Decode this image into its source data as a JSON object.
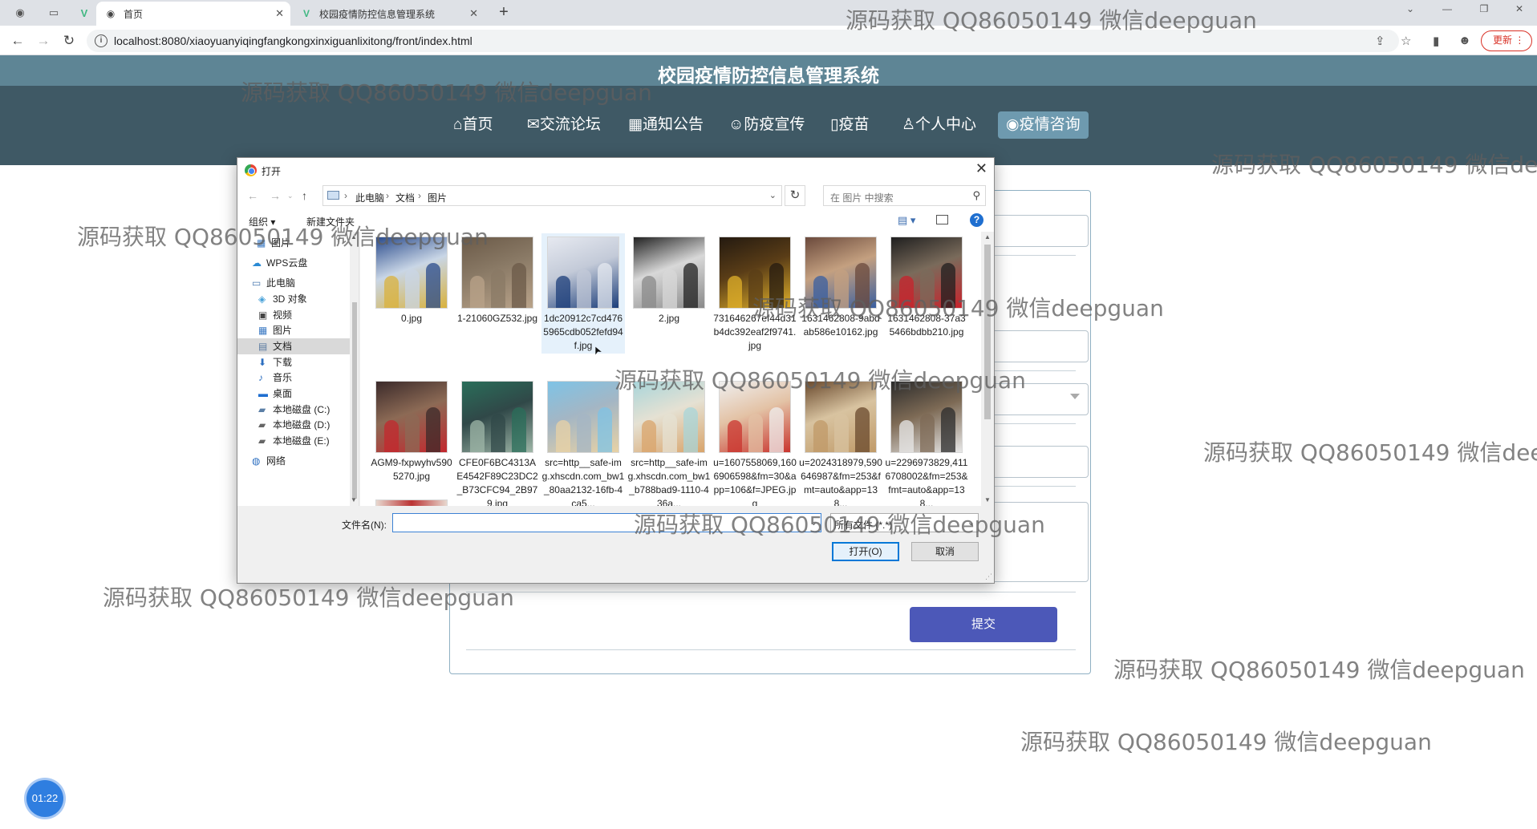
{
  "browser": {
    "tabs": [
      {
        "label": "首页",
        "favicon": "globe-icon"
      },
      {
        "label": "校园疫情防控信息管理系统",
        "favicon": "vue-logo-icon"
      }
    ],
    "url": "localhost:8080/xiaoyuanyiqingfangkongxinxiguanlixitong/front/index.html",
    "update_label": "更新"
  },
  "site": {
    "title": "校园疫情防控信息管理系统",
    "nav": [
      {
        "icon": "⌂",
        "label": "首页"
      },
      {
        "icon": "✉",
        "label": "交流论坛"
      },
      {
        "icon": "▦",
        "label": "通知公告"
      },
      {
        "icon": "☺",
        "label": "防疫宣传"
      },
      {
        "icon": "▯",
        "label": "疫苗"
      },
      {
        "icon": "♙",
        "label": "个人中心"
      },
      {
        "icon": "◉",
        "label": "疫情咨询"
      }
    ],
    "active_nav": "疫情咨询",
    "accent_color": "#4c58b8"
  },
  "form": {
    "submit_label": "提交"
  },
  "timer": "01:22",
  "dialog": {
    "title": "打开",
    "breadcrumb": [
      "此电脑",
      "文档",
      "图片"
    ],
    "search_placeholder": "在 图片 中搜索",
    "organize_label": "组织 ▾",
    "new_folder_label": "新建文件夹",
    "sidebar": [
      {
        "label": "图片",
        "icon": "pictures-folder-icon"
      },
      {
        "label": "WPS云盘",
        "icon": "cloud-icon"
      },
      {
        "label": "此电脑",
        "icon": "computer-icon"
      },
      {
        "label": "3D 对象",
        "icon": "3d-objects-icon"
      },
      {
        "label": "视频",
        "icon": "video-folder-icon"
      },
      {
        "label": "图片",
        "icon": "pictures-folder-icon"
      },
      {
        "label": "文档",
        "icon": "documents-folder-icon",
        "selected": true
      },
      {
        "label": "下载",
        "icon": "download-icon"
      },
      {
        "label": "音乐",
        "icon": "music-icon"
      },
      {
        "label": "桌面",
        "icon": "desktop-icon"
      },
      {
        "label": "本地磁盘 (C:)",
        "icon": "drive-c-icon"
      },
      {
        "label": "本地磁盘 (D:)",
        "icon": "drive-icon"
      },
      {
        "label": "本地磁盘 (E:)",
        "icon": "drive-icon"
      },
      {
        "label": "网络",
        "icon": "network-icon"
      }
    ],
    "files": [
      {
        "name": "0.jpg",
        "thumb": [
          "#2a4b8c",
          "#d9b23d",
          "#c9d6e6"
        ]
      },
      {
        "name": "1-21060GZ532.jpg",
        "thumb": [
          "#6b5a48",
          "#b9a38a",
          "#8a7a66"
        ]
      },
      {
        "name": "1dc20912c7cd4765965cdb052fefd94f.jpg",
        "thumb": [
          "#e6e9f0",
          "#1c3e7a",
          "#c3cad8"
        ],
        "selected": true
      },
      {
        "name": "2.jpg",
        "thumb": [
          "#222222",
          "#8a8a8a",
          "#d8d8d8"
        ]
      },
      {
        "name": "731646267ef44d31b4dc392eaf2f9741.jpg",
        "thumb": [
          "#241a10",
          "#e0b02a",
          "#5a3d17"
        ]
      },
      {
        "name": "1631462808-9abdab586e10162.jpg",
        "thumb": [
          "#6b4a3c",
          "#3a5fa0",
          "#c4a080"
        ]
      },
      {
        "name": "1631462808-37a35466bdbb210.jpg",
        "thumb": [
          "#1f1f1f",
          "#c8232c",
          "#7a6b5b"
        ]
      },
      {
        "name": "AGM9-fxpwyhv5905270.jpg",
        "thumb": [
          "#3b2a2a",
          "#c3282e",
          "#8c6a55"
        ]
      },
      {
        "name": "CFE0F6BC4313AE4542F89C23DC2_B73CFC94_2B979.jpg",
        "thumb": [
          "#2a6e5a",
          "#9fb7a8",
          "#304848"
        ]
      },
      {
        "name": "src=http__safe-img.xhscdn.com_bw1_80aa2132-16fb-4ca5...",
        "thumb": [
          "#7ec3e6",
          "#e8d2a5",
          "#a4b6c4"
        ]
      },
      {
        "name": "src=http__safe-img.xhscdn.com_bw1_b788bad9-1110-436a...",
        "thumb": [
          "#a8d5da",
          "#d9a46b",
          "#e5e1d3"
        ]
      },
      {
        "name": "u=1607558069,1606906598&fm=30&app=106&f=JPEG.jpg",
        "thumb": [
          "#efefef",
          "#c9342e",
          "#e3c2a5"
        ]
      },
      {
        "name": "u=2024318979,590646987&fm=253&fmt=auto&app=138...",
        "thumb": [
          "#6a4a2e",
          "#c09a68",
          "#d8c3a0"
        ]
      },
      {
        "name": "u=2296973829,4116708002&fm=253&fmt=auto&app=138...",
        "thumb": [
          "#2b2b2b",
          "#e8e8e8",
          "#7d6a55"
        ]
      }
    ],
    "filename_label": "文件名(N):",
    "filename_value": "",
    "filetype_value": "所有文件 (*.*)",
    "open_label": "打开(O)",
    "cancel_label": "取消"
  },
  "watermark_text": "源码获取 QQ86050149 微信deepguan"
}
